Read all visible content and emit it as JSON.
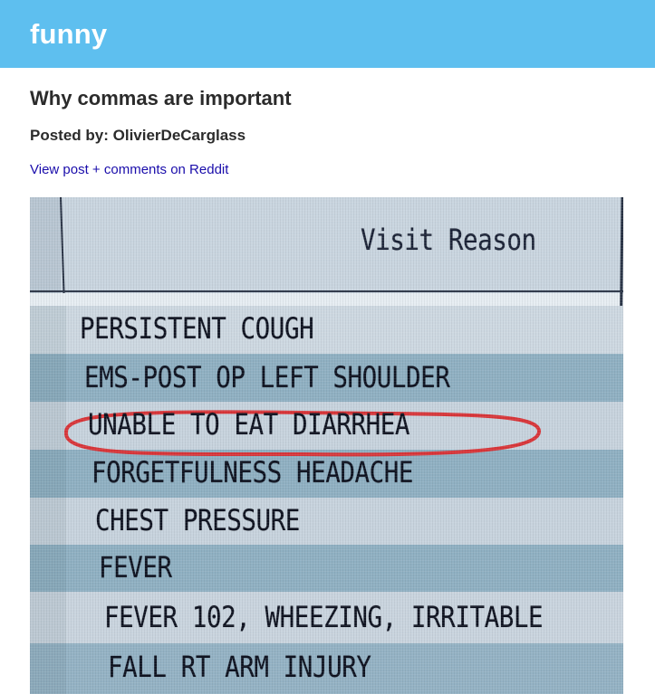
{
  "header": {
    "subreddit": "funny"
  },
  "post": {
    "title": "Why commas are important",
    "posted_by": "Posted by: OlivierDeCarglass",
    "link_text": "View post + comments on Reddit"
  },
  "image": {
    "column_header": "Visit Reason",
    "rows": [
      "PERSISTENT COUGH",
      "EMS-POST OP LEFT SHOULDER",
      "UNABLE TO EAT DIARRHEA",
      "FORGETFULNESS HEADACHE",
      "CHEST PRESSURE",
      "FEVER",
      "FEVER 102, WHEEZING, IRRITABLE",
      "FALL RT ARM INJURY"
    ],
    "circled_row_index": 2,
    "circle_color": "#d8363a"
  },
  "colors": {
    "header_bg": "#5ebfef",
    "link": "#1a0dab"
  }
}
